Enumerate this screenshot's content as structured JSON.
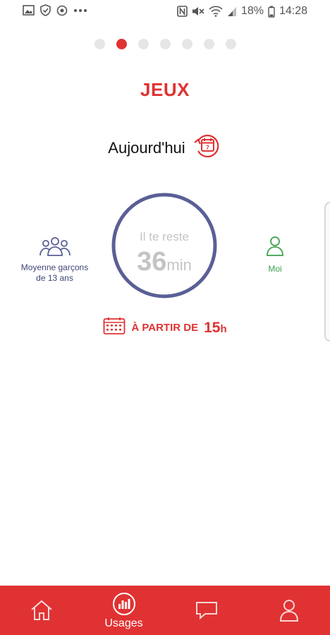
{
  "status_bar": {
    "battery": "18%",
    "time": "14:28"
  },
  "pager": {
    "count": 7,
    "active_index": 1
  },
  "screen": {
    "title": "JEUX",
    "date_label": "Aujourd'hui",
    "calendar_day": "7"
  },
  "comparison": {
    "left_label_line1": "Moyenne garçons",
    "left_label_line2": "de 13 ans",
    "right_label": "Moi"
  },
  "ring": {
    "caption": "Il te reste",
    "value": "36",
    "unit": "min"
  },
  "availability": {
    "label": "À PARTIR DE",
    "value": "15",
    "unit": "h"
  },
  "bottom_nav": {
    "usages_label": "Usages"
  },
  "colors": {
    "accent": "#e03232",
    "ring": "#5a5f96",
    "left_label": "#3f4678",
    "right_label": "#3fa14b"
  },
  "icons": {
    "status_left": [
      "image-icon",
      "shield-icon",
      "sync-icon",
      "more-dots-icon"
    ],
    "status_right": [
      "nfc-icon",
      "mute-icon",
      "wifi-icon",
      "signal-icon",
      "battery-icon"
    ],
    "nav": [
      "home-icon",
      "usages-chart-icon",
      "chat-icon",
      "profile-icon"
    ]
  }
}
